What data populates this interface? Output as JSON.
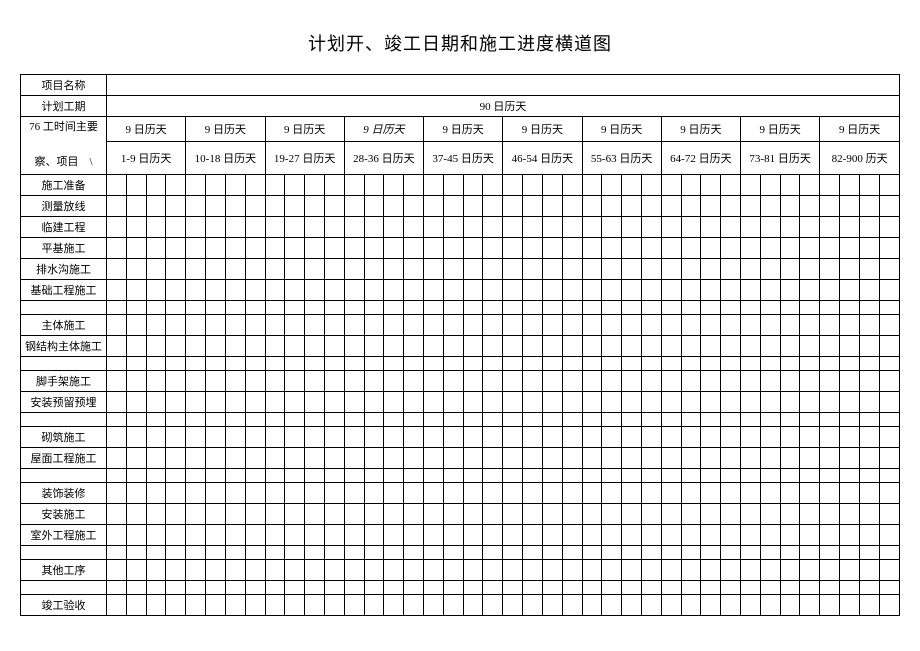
{
  "title": "计划开、竣工日期和施工进度横道图",
  "rows": {
    "project_name_label": "项目名称",
    "plan_duration_label": "计划工期",
    "plan_duration_value": "90 日历天",
    "time_header_line1": "76 工时间主要",
    "time_header_line2": "察、项目　\\"
  },
  "period_groups": [
    {
      "top": "9 日历天",
      "bottom": "1-9 日历天"
    },
    {
      "top": "9 日历天",
      "bottom": "10-18 日历天"
    },
    {
      "top": "9 日历天",
      "bottom": "19-27 日历天"
    },
    {
      "top": "9 日历天",
      "bottom": "28-36 日历天",
      "italic_top": true
    },
    {
      "top": "9 日历天",
      "bottom": "37-45 日历天"
    },
    {
      "top": "9 日历天",
      "bottom": "46-54 日历天"
    },
    {
      "top": "9 日历天",
      "bottom": "55-63 日历天"
    },
    {
      "top": "9 日历天",
      "bottom": "64-72 日历天"
    },
    {
      "top": "9 日历天",
      "bottom": "73-81 日历天"
    },
    {
      "top": "9 日历天",
      "bottom": "82-900 历天"
    }
  ],
  "tasks": [
    {
      "label": "施工准备"
    },
    {
      "label": "测量放线"
    },
    {
      "label": "临建工程"
    },
    {
      "label": "平基施工"
    },
    {
      "label": "排水沟施工"
    },
    {
      "label": "基础工程施工"
    },
    {
      "label": "",
      "spacer": true
    },
    {
      "label": "主体施工"
    },
    {
      "label": "钢结构主体施工"
    },
    {
      "label": "",
      "spacer": true
    },
    {
      "label": "脚手架施工"
    },
    {
      "label": "安装预留预埋"
    },
    {
      "label": "",
      "spacer": true
    },
    {
      "label": "砌筑施工"
    },
    {
      "label": "屋面工程施工"
    },
    {
      "label": "",
      "spacer": true
    },
    {
      "label": "装饰装修"
    },
    {
      "label": "安装施工"
    },
    {
      "label": "室外工程施工"
    },
    {
      "label": "",
      "spacer": true
    },
    {
      "label": "其他工序"
    },
    {
      "label": "",
      "spacer": true
    },
    {
      "label": "竣工验收"
    }
  ]
}
